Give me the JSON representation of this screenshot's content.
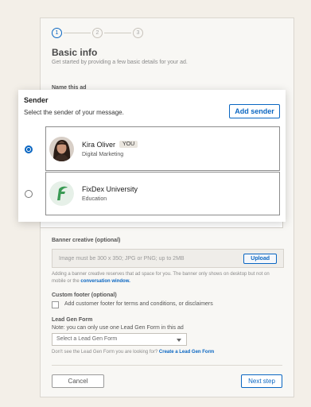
{
  "form": {
    "steps": [
      "1",
      "2",
      "3"
    ],
    "title": "Basic info",
    "subtitle": "Get started by providing a few basic details for your ad.",
    "name_label": "Name this ad",
    "banner_label": "Banner creative (optional)",
    "banner_placeholder": "Image must be 300 x 350; JPG or PNG; up to 2MB",
    "upload_label": "Upload",
    "banner_note": "Adding a banner creative reserves that ad space for you. The banner only shows on desktop but not on mobile or the",
    "banner_note_link": "conversation window.",
    "custom_footer_label": "Custom footer (optional)",
    "custom_footer_checkbox": "Add customer footer for terms and conditions, or disclaimers",
    "lead_gen_label": "Lead Gen Form",
    "lead_gen_note": "Note: you can only use one Lead Gen Form in this ad",
    "lead_gen_select": "Select a Lead Gen Form",
    "lead_gen_help": "Don't see the Lead Gen Form you are looking for?",
    "lead_gen_help_link": "Create a Lead Gen Form",
    "cancel_label": "Cancel",
    "next_label": "Next step"
  },
  "sender": {
    "title": "Sender",
    "subtitle": "Select the sender of your message.",
    "add_label": "Add sender",
    "options": [
      {
        "name": "Kira Oliver",
        "badge": "YOU",
        "role": "Digital Marketing",
        "selected": true
      },
      {
        "name": "FixDex University",
        "badge": "",
        "role": "Education",
        "selected": false
      }
    ]
  },
  "colors": {
    "accent": "#0a66c2",
    "logo_green": "#3a9a54"
  }
}
